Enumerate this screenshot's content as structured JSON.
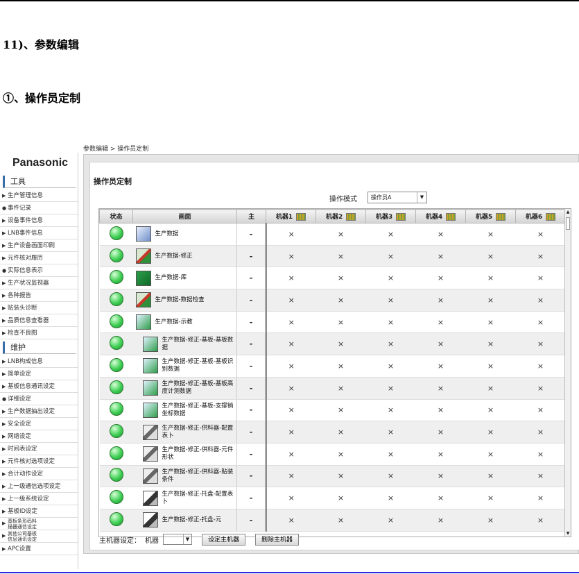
{
  "doc": {
    "heading1": "11)、参数编辑",
    "heading2": "①、操作员定制"
  },
  "breadcrumb": "参数编辑 > 操作员定制",
  "sidebar": {
    "brand": "Panasonic",
    "group_tools": "工具",
    "group_maintain": "维护",
    "tools_items": [
      {
        "marker": "▶",
        "label": "生产管理信息"
      },
      {
        "marker": "●",
        "label": "事件记录"
      },
      {
        "marker": "▶",
        "label": "设备事件信息"
      },
      {
        "marker": "▶",
        "label": "LNB事件信息"
      },
      {
        "marker": "▶",
        "label": "生产设备画面印刷"
      },
      {
        "marker": "▶",
        "label": "元件核对履历"
      },
      {
        "marker": "●",
        "label": "实际信息表示"
      },
      {
        "marker": "▶",
        "label": "生产状况监视器"
      },
      {
        "marker": "▶",
        "label": "各种报告"
      },
      {
        "marker": "▶",
        "label": "贴装头诊断"
      },
      {
        "marker": "▶",
        "label": "品质信息查看器"
      },
      {
        "marker": "▶",
        "label": "检查不良图"
      }
    ],
    "maintain_items": [
      {
        "marker": "▶",
        "label": "LNB构成信息"
      },
      {
        "marker": "▶",
        "label": "简单设定"
      },
      {
        "marker": "▶",
        "label": "基板信息通讯设定"
      },
      {
        "marker": "●",
        "label": "详细设定"
      },
      {
        "marker": "▶",
        "label": "生产数据抽出设定"
      },
      {
        "marker": "▶",
        "label": "安全设定"
      },
      {
        "marker": "▶",
        "label": "网络设定"
      },
      {
        "marker": "▶",
        "label": "时间表设定"
      },
      {
        "marker": "▶",
        "label": "元件核对选项设定"
      },
      {
        "marker": "▶",
        "label": "合计动作设定"
      },
      {
        "marker": "▶",
        "label": "上一级通信选项设定"
      },
      {
        "marker": "▶",
        "label": "上一级系统设定"
      },
      {
        "marker": "▶",
        "label": "基板ID设定"
      }
    ],
    "small_items": [
      {
        "marker": "▶",
        "line1": "基板条形码料",
        "line2": "描器通信设定"
      },
      {
        "marker": "▶",
        "line1": "其他公司基板",
        "line2": "信息通讯设定"
      }
    ],
    "last_item": {
      "marker": "▶",
      "label": "APC设置"
    }
  },
  "panel": {
    "title": "操作员定制",
    "mode_label": "操作模式",
    "mode_value": "操作员A",
    "columns": [
      "状态",
      "画面",
      "主",
      "机器1",
      "机器2",
      "机器3",
      "机器4",
      "机器5",
      "机器6"
    ],
    "rows": [
      {
        "icon": "b",
        "screen": "生产数据",
        "main": "-",
        "m": [
          "×",
          "×",
          "×",
          "×",
          "×",
          "×"
        ]
      },
      {
        "icon": "m",
        "screen": "生产数据-修正",
        "main": "-",
        "m": [
          "×",
          "×",
          "×",
          "×",
          "×",
          "×"
        ]
      },
      {
        "icon": "g",
        "screen": "生产数据-库",
        "main": "-",
        "m": [
          "×",
          "×",
          "×",
          "×",
          "×",
          "×"
        ]
      },
      {
        "icon": "m",
        "screen": "生产数据-数据检查",
        "main": "-",
        "m": [
          "×",
          "×",
          "×",
          "×",
          "×",
          "×"
        ]
      },
      {
        "icon": "t",
        "screen": "生产数据-示教",
        "main": "-",
        "m": [
          "×",
          "×",
          "×",
          "×",
          "×",
          "×"
        ]
      },
      {
        "icon": "t",
        "screen": "生产数据-修正-基板-基板数据",
        "main": "-",
        "m": [
          "×",
          "×",
          "×",
          "×",
          "×",
          "×"
        ]
      },
      {
        "icon": "t",
        "screen": "生产数据-修正-基板-基板识别数据",
        "main": "-",
        "m": [
          "×",
          "×",
          "×",
          "×",
          "×",
          "×"
        ]
      },
      {
        "icon": "t",
        "screen": "生产数据-修正-基板-基板高度计测数据",
        "main": "-",
        "m": [
          "×",
          "×",
          "×",
          "×",
          "×",
          "×"
        ]
      },
      {
        "icon": "t",
        "screen": "生产数据-修正-基板-支撑销坐标数据",
        "main": "-",
        "m": [
          "×",
          "×",
          "×",
          "×",
          "×",
          "×"
        ]
      },
      {
        "icon": "f",
        "screen": "生产数据-修正-供料器-配置表卜",
        "main": "-",
        "m": [
          "×",
          "×",
          "×",
          "×",
          "×",
          "×"
        ]
      },
      {
        "icon": "f",
        "screen": "生产数据-修正-供料器-元件形状",
        "main": "-",
        "m": [
          "×",
          "×",
          "×",
          "×",
          "×",
          "×"
        ]
      },
      {
        "icon": "f",
        "screen": "生产数据-修正-供料器-贴装条件",
        "main": "-",
        "m": [
          "×",
          "×",
          "×",
          "×",
          "×",
          "×"
        ]
      },
      {
        "icon": "d",
        "screen": "生产数据-修正-托盘-配置表卜",
        "main": "-",
        "m": [
          "×",
          "×",
          "×",
          "×",
          "×",
          "×"
        ]
      },
      {
        "icon": "d",
        "screen": "生产数据-修正-托盘-元",
        "main": "-",
        "m": [
          "×",
          "×",
          "×",
          "×",
          "×",
          "×"
        ]
      }
    ],
    "footer": {
      "label": "主机器设定：",
      "machine_label": "机器",
      "machine_value": "",
      "set_button": "设定主机器",
      "delete_button": "删除主机器"
    }
  }
}
